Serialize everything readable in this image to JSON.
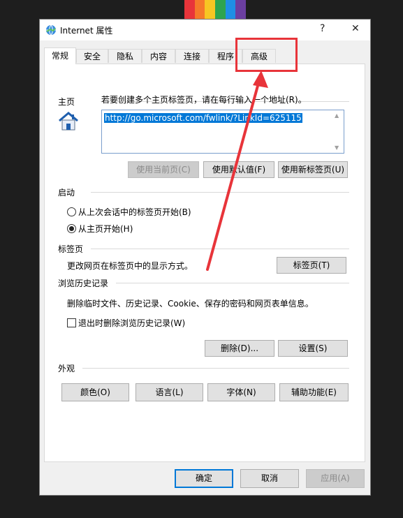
{
  "colors": {
    "stripes": [
      "#e8343a",
      "#f5792a",
      "#f7c623",
      "#2ea44f",
      "#1f8fe5",
      "#6b3fa0"
    ],
    "annotation": "#e8343a",
    "accent": "#0078d7"
  },
  "window": {
    "title": "Internet 属性",
    "help": "?",
    "close": "✕"
  },
  "tabs": [
    "常规",
    "安全",
    "隐私",
    "内容",
    "连接",
    "程序",
    "高级"
  ],
  "homepage": {
    "section": "主页",
    "instruction": "若要创建多个主页标签页，请在每行输入一个地址(R)。",
    "url": "http://go.microsoft.com/fwlink/?LinkId=625115",
    "btn_current": "使用当前页(C)",
    "btn_default": "使用默认值(F)",
    "btn_newtab": "使用新标签页(U)"
  },
  "startup": {
    "section": "启动",
    "option1": "从上次会话中的标签页开始(B)",
    "option2": "从主页开始(H)",
    "selected": 2
  },
  "tabsection": {
    "section": "标签页",
    "desc": "更改网页在标签页中的显示方式。",
    "btn": "标签页(T)"
  },
  "history": {
    "section": "浏览历史记录",
    "desc": "删除临时文件、历史记录、Cookie、保存的密码和网页表单信息。",
    "checkbox": "退出时删除浏览历史记录(W)",
    "checked": false,
    "btn_delete": "删除(D)...",
    "btn_settings": "设置(S)"
  },
  "appearance": {
    "section": "外观",
    "btn_colors": "颜色(O)",
    "btn_language": "语言(L)",
    "btn_fonts": "字体(N)",
    "btn_access": "辅助功能(E)"
  },
  "footer": {
    "ok": "确定",
    "cancel": "取消",
    "apply": "应用(A)"
  }
}
